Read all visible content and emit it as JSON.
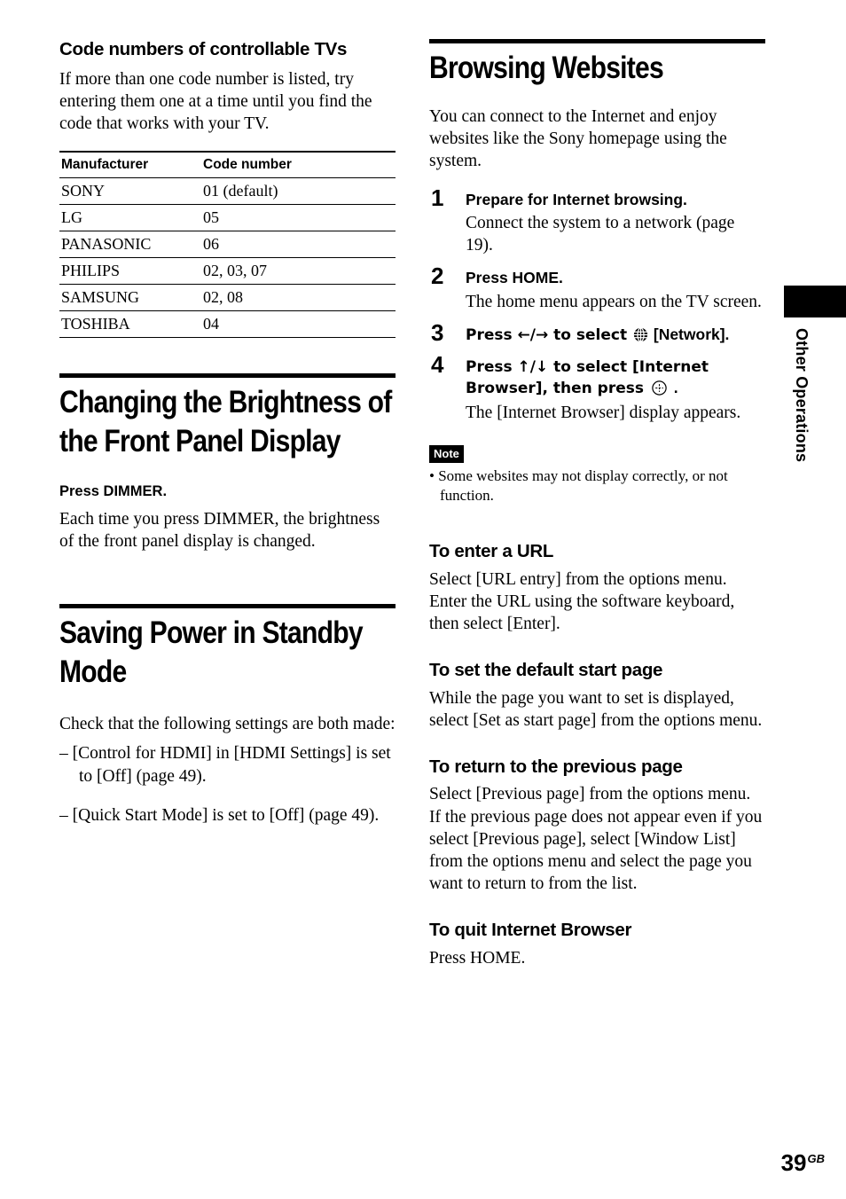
{
  "left_column": {
    "tv_codes": {
      "heading": "Code numbers of controllable TVs",
      "intro": "If more than one code number is listed, try entering them one at a time until you find the code that works with your TV.",
      "table": {
        "headers": [
          "Manufacturer",
          "Code number"
        ],
        "rows": [
          [
            "SONY",
            "01 (default)"
          ],
          [
            "LG",
            "05"
          ],
          [
            "PANASONIC",
            "06"
          ],
          [
            "PHILIPS",
            "02, 03, 07"
          ],
          [
            "SAMSUNG",
            "02, 08"
          ],
          [
            "TOSHIBA",
            "04"
          ]
        ]
      }
    },
    "brightness": {
      "title": "Changing the Brightness of the Front Panel Display",
      "lead": "Press DIMMER.",
      "body": "Each time you press DIMMER, the brightness of the front panel display is changed."
    },
    "standby": {
      "title": "Saving Power in Standby Mode",
      "intro": "Check that the following settings are both made:",
      "items": [
        "– [Control for HDMI] in [HDMI Settings] is set to [Off] (page 49).",
        "– [Quick Start Mode] is set to [Off] (page 49)."
      ]
    }
  },
  "right_column": {
    "browsing": {
      "title": "Browsing Websites",
      "intro": "You can connect to the Internet and enjoy websites like the Sony homepage using the system.",
      "steps": [
        {
          "number": "1",
          "title": "Prepare for Internet browsing.",
          "desc": "Connect the system to a network (page 19)."
        },
        {
          "number": "2",
          "title": "Press HOME.",
          "desc": "The home menu appears on the TV screen."
        },
        {
          "number": "3",
          "title_pre": "Press ←/→ to select ",
          "title_post": " [Network].",
          "desc": ""
        },
        {
          "number": "4",
          "title_pre": "Press ↑/↓ to select [Internet Browser], then press ",
          "title_post": " .",
          "desc": "The [Internet Browser] display appears."
        }
      ],
      "note": {
        "badge": "Note",
        "text": "• Some websites may not display correctly, or not function."
      }
    },
    "subsections": [
      {
        "heading": "To enter a URL",
        "body": "Select [URL entry] from the options menu. Enter the URL using the software keyboard, then select [Enter]."
      },
      {
        "heading": "To set the default start page",
        "body": "While the page you want to set is displayed, select [Set as start page] from the options menu."
      },
      {
        "heading": "To return to the previous page",
        "body": "Select [Previous page] from the options menu. If the previous page does not appear even if you select [Previous page], select [Window List] from the options menu and select the page you want to return to from the list."
      },
      {
        "heading": "To quit Internet Browser",
        "body": "Press HOME."
      }
    ]
  },
  "edge_tab": {
    "label": "Other Operations"
  },
  "folio": {
    "page": "39",
    "suffix": "GB"
  }
}
